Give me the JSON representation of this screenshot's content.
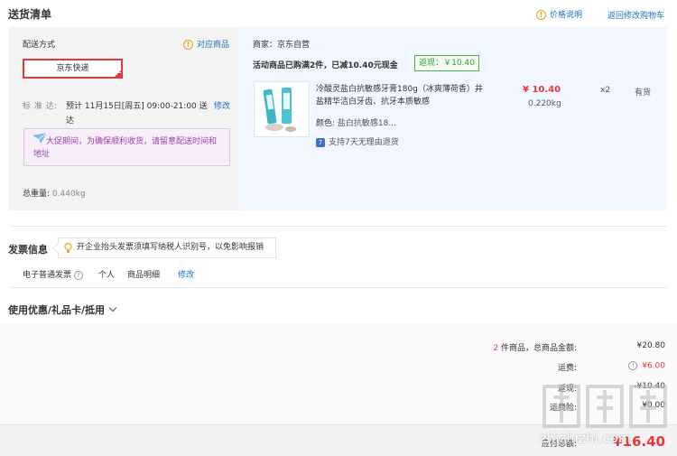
{
  "header": {
    "title": "送货清单",
    "price_help": "价格说明",
    "back_to_cart": "返回修改购物车"
  },
  "delivery": {
    "method_label": "配送方式",
    "match_goods": "对应商品",
    "selected_method": "京东快递",
    "standard_label": "标 准 达:",
    "standard_text": "预计 11月15日[周五] 09:00-21:00 送达",
    "modify": "修改",
    "notice": "大促期间，为确保顺利收货，请留意配送时间和地址",
    "total_weight_label": "总重量:",
    "total_weight_value": "0.440kg"
  },
  "shop": {
    "merchant": "商家：京东自营",
    "promo": "活动商品已购满2件，已减10.40元现金",
    "rebate": "返现：￥10.40",
    "product": {
      "name": "冷酸灵盐白抗敏感牙膏180g（冰爽薄荷香）井盐精华洁白牙齿、抗牙本质敏感",
      "color_label": "颜色:",
      "color_value": "盐白抗敏感18...",
      "return_policy": "支持7天无理由退货",
      "return_badge": "7",
      "price": "¥ 10.40",
      "weight": "0.220kg",
      "qty": "x2",
      "stock": "有货"
    }
  },
  "invoice": {
    "title": "发票信息",
    "tip": "开企业抬头发票须填写纳税人识别号，以免影响报销",
    "type": "电子普通发票",
    "person": "个人",
    "detail": "商品明细",
    "modify": "修改"
  },
  "coupon": {
    "title": "使用优惠/礼品卡/抵用"
  },
  "summary": {
    "count_num": "2",
    "count_text": " 件商品，总商品金额:",
    "goods_total": "¥20.80",
    "freight_label": "运费:",
    "freight_value": "¥6.00",
    "rebate_label": "返现:",
    "rebate_value": "-¥10.40",
    "service_label": "运费险:",
    "service_value": "¥0.00",
    "payable_label": "应付总额:",
    "payable_value": "¥16.40"
  },
  "watermark": {
    "text": "zhizhizhi.com",
    "glyph": "值"
  },
  "colors": {
    "accent_red": "#e4393c",
    "link_blue": "#1e6fc4",
    "rebate_green": "#4caf50",
    "notice_purple": "#9b3fae"
  }
}
